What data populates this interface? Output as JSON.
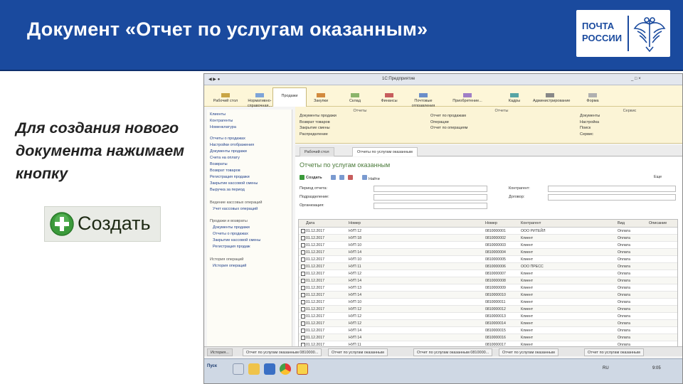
{
  "slide": {
    "title": "Документ «Отчет по услугам оказанным»",
    "instruction": "Для создания нового документа нажимаем кнопку",
    "create_button_label": "Создать",
    "logo_text_line1": "ПОЧТА",
    "logo_text_line2": "РОССИИ"
  },
  "window": {
    "title": "1С:Предприятие"
  },
  "sections": [
    {
      "label": "Рабочий стол"
    },
    {
      "label": "Нормативно-справочная..."
    },
    {
      "label": "Продажи"
    },
    {
      "label": "Закупки"
    },
    {
      "label": "Склад"
    },
    {
      "label": "Финансы"
    },
    {
      "label": "Почтовые отправления"
    },
    {
      "label": "Приобретение..."
    },
    {
      "label": "Кадры"
    },
    {
      "label": "Администрирование"
    },
    {
      "label": "Форма"
    }
  ],
  "left_panel": {
    "top_links": [
      "Клиенты",
      "Контрагенты",
      "Номенклатура"
    ],
    "links": [
      "Отчеты о продажах",
      "Настройки отображения",
      "Документы продажи",
      "Счета на оплату",
      "Возвраты",
      "Возврат товаров",
      "Регистрация продажи",
      "Закрытие кассовой смены",
      "Выручка за период"
    ],
    "group_cash": "Ведение кассовых операций",
    "group_cash_item": "Учет кассовых операций",
    "group_sales": "Продажи и возвраты",
    "group_sales_items": [
      "Документы продажи",
      "Отчеты о продажах",
      "Закрытие кассовой смены",
      "Регистрация продаж"
    ],
    "group_history": "История операций",
    "group_history_item": "История операций"
  },
  "dashboard": {
    "col1_header": "Отчеты",
    "col1_items": [
      "Документы продажи",
      "Возврат товаров",
      "Закрытие смены",
      "Распределение"
    ],
    "col2_header": "Отчеты",
    "col2_items": [
      "Отчет по продажам",
      "Операции",
      "Отчет по операциям"
    ],
    "col3_header": "Сервис",
    "col3_items": [
      "Документы",
      "Настройка",
      "Поиск",
      "Сервис"
    ]
  },
  "tabs": {
    "first": "Рабочий стол",
    "active": "Отчеты по услугам оказанным"
  },
  "form": {
    "title": "Отчеты по услугам оказанным",
    "toolbar_create": "Создать",
    "toolbar_find": "Найти",
    "toolbar_more": "Еще",
    "filter_labels": [
      "Период отчета:",
      "Подразделение:",
      "Организация:",
      "Контрагент:",
      "Договор:"
    ],
    "columns": [
      "Дата",
      "Номер",
      "Номер",
      "Контрагент",
      "Вид",
      "Описание"
    ],
    "rows": [
      [
        "01.12.2017",
        "НУП 12",
        "0810000001",
        "ООО РИТЕЙЛ",
        "Оплата",
        ""
      ],
      [
        "01.12.2017",
        "НУП 18",
        "0810000002",
        "Клиент",
        "Оплата",
        ""
      ],
      [
        "01.12.2017",
        "НУП 10",
        "0810000003",
        "Клиент",
        "Оплата",
        ""
      ],
      [
        "01.12.2017",
        "НУП 14",
        "0810000004",
        "Клиент",
        "Оплата",
        ""
      ],
      [
        "01.12.2017",
        "НУП 10",
        "0810000005",
        "Клиент",
        "Оплата",
        ""
      ],
      [
        "01.12.2017",
        "НУП 11",
        "0810000006",
        "ООО ПРЕСС",
        "Оплата",
        ""
      ],
      [
        "01.12.2017",
        "НУП 12",
        "0810000007",
        "Клиент",
        "Оплата",
        ""
      ],
      [
        "01.12.2017",
        "НУП 14",
        "0810000008",
        "Клиент",
        "Оплата",
        ""
      ],
      [
        "01.12.2017",
        "НУП 13",
        "0810000009",
        "Клиент",
        "Оплата",
        ""
      ],
      [
        "01.12.2017",
        "НУП 14",
        "0810000010",
        "Клиент",
        "Оплата",
        ""
      ],
      [
        "01.12.2017",
        "НУП 10",
        "0810000011",
        "Клиент",
        "Оплата",
        ""
      ],
      [
        "01.12.2017",
        "НУП 12",
        "0810000012",
        "Клиент",
        "Оплата",
        ""
      ],
      [
        "01.12.2017",
        "НУП 12",
        "0810000013",
        "Клиент",
        "Оплата",
        ""
      ],
      [
        "01.12.2017",
        "НУП 12",
        "0810000014",
        "Клиент",
        "Оплата",
        ""
      ],
      [
        "01.12.2017",
        "НУП 14",
        "0810000015",
        "Клиент",
        "Оплата",
        ""
      ],
      [
        "01.12.2017",
        "НУП 14",
        "0810000016",
        "Клиент",
        "Оплата",
        ""
      ],
      [
        "01.12.2017",
        "НУП 11",
        "0810000017",
        "Клиент",
        "Оплата",
        ""
      ],
      [
        "01.12.2017",
        "НУП 13",
        "0810000018",
        "Клиент",
        "Оплата",
        ""
      ]
    ]
  },
  "app_taskbar": {
    "buttons": [
      "История...",
      "Отчет по услугам оказанным 0810000...",
      "Отчет по услугам оказанным",
      "Отчет по услугам оказанным 0810000...",
      "Отчет по услугам оказанным",
      "Отчет по услугам оказанным"
    ]
  },
  "os_taskbar": {
    "start": "Пуск",
    "lang": "RU",
    "time": "9:05"
  },
  "colors": {
    "banner": "#1a4a9e",
    "create_plus": "#3b9a3b"
  }
}
